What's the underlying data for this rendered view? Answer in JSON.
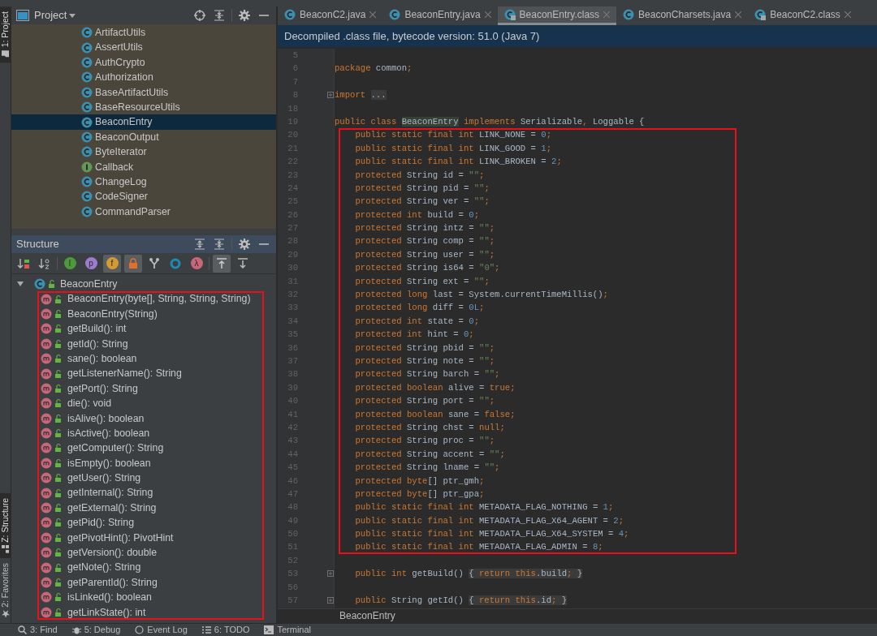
{
  "side_tabs_top": [
    {
      "label": "1: Project",
      "kind": "folder",
      "selected": true
    }
  ],
  "side_tabs_bottom": [
    {
      "label": "Z: Structure",
      "kind": "structure",
      "selected": true
    },
    {
      "label": "2: Favorites",
      "kind": "star",
      "selected": false
    }
  ],
  "project": {
    "title": "Project",
    "items": [
      {
        "label": "ArtifactUtils",
        "kind": "class",
        "selected": false
      },
      {
        "label": "AssertUtils",
        "kind": "class",
        "selected": false
      },
      {
        "label": "AuthCrypto",
        "kind": "class",
        "selected": false
      },
      {
        "label": "Authorization",
        "kind": "class",
        "selected": false
      },
      {
        "label": "BaseArtifactUtils",
        "kind": "class",
        "selected": false
      },
      {
        "label": "BaseResourceUtils",
        "kind": "class",
        "selected": false
      },
      {
        "label": "BeaconEntry",
        "kind": "class",
        "selected": true
      },
      {
        "label": "BeaconOutput",
        "kind": "class",
        "selected": false
      },
      {
        "label": "ByteIterator",
        "kind": "class",
        "selected": false
      },
      {
        "label": "Callback",
        "kind": "interface",
        "selected": false
      },
      {
        "label": "ChangeLog",
        "kind": "class",
        "selected": false
      },
      {
        "label": "CodeSigner",
        "kind": "class",
        "selected": false
      },
      {
        "label": "CommandParser",
        "kind": "class",
        "selected": false
      }
    ]
  },
  "structure": {
    "title": "Structure",
    "toolbar": [
      {
        "kind": "sort-visibility",
        "on": false
      },
      {
        "kind": "sort-alpha",
        "on": false
      },
      {
        "kind": "badge",
        "glyph": "I",
        "color": "#4c9a3c",
        "on": false
      },
      {
        "kind": "badge",
        "glyph": "p",
        "color": "#9b7cce",
        "on": false
      },
      {
        "kind": "badge",
        "glyph": "f",
        "color": "#d49a33",
        "on": true
      },
      {
        "kind": "lock",
        "on": true
      },
      {
        "kind": "fork",
        "on": false
      },
      {
        "kind": "ring",
        "on": false
      },
      {
        "kind": "badge",
        "glyph": "λ",
        "color": "#c8677a",
        "on": false
      },
      {
        "kind": "scroll-to-source",
        "on": true
      },
      {
        "kind": "scroll-from-source",
        "on": false
      }
    ],
    "root": {
      "label": "BeaconEntry",
      "expanded": true,
      "children": [
        {
          "label": "BeaconEntry(byte[], String, String, String)",
          "highlighted": true
        },
        {
          "label": "BeaconEntry(String)",
          "highlighted": true
        },
        {
          "label": "getBuild(): int",
          "highlighted": true
        },
        {
          "label": "getId(): String",
          "highlighted": true
        },
        {
          "label": "sane(): boolean",
          "highlighted": true
        },
        {
          "label": "getListenerName(): String",
          "highlighted": true
        },
        {
          "label": "getPort(): String",
          "highlighted": true
        },
        {
          "label": "die(): void",
          "highlighted": true
        },
        {
          "label": "isAlive(): boolean",
          "highlighted": true
        },
        {
          "label": "isActive(): boolean",
          "highlighted": true
        },
        {
          "label": "getComputer(): String",
          "highlighted": true
        },
        {
          "label": "isEmpty(): boolean",
          "highlighted": true
        },
        {
          "label": "getUser(): String",
          "highlighted": true
        },
        {
          "label": "getInternal(): String",
          "highlighted": true
        },
        {
          "label": "getExternal(): String",
          "highlighted": true
        },
        {
          "label": "getPid(): String",
          "highlighted": true
        },
        {
          "label": "getPivotHint(): PivotHint",
          "highlighted": true
        },
        {
          "label": "getVersion(): double",
          "highlighted": true
        },
        {
          "label": "getNote(): String",
          "highlighted": true
        },
        {
          "label": "getParentId(): String",
          "highlighted": true
        },
        {
          "label": "isLinked(): boolean",
          "highlighted": true
        },
        {
          "label": "getLinkState(): int",
          "highlighted": true
        }
      ]
    }
  },
  "editor": {
    "tabs": [
      {
        "label": "BeaconC2.java",
        "kind": "java",
        "selected": false
      },
      {
        "label": "BeaconEntry.java",
        "kind": "java",
        "selected": false
      },
      {
        "label": "BeaconEntry.class",
        "kind": "class",
        "selected": true
      },
      {
        "label": "BeaconCharsets.java",
        "kind": "java",
        "selected": false
      },
      {
        "label": "BeaconC2.class",
        "kind": "class",
        "selected": false
      }
    ],
    "banner": "Decompiled .class file, bytecode version: 51.0 (Java 7)",
    "lines": [
      {
        "n": "5",
        "fold_marker": false
      },
      {
        "n": "6",
        "highlighted": false,
        "fold_marker": false,
        "t": [
          {
            "kind": "keyword",
            "text": "package "
          },
          {
            "kind": "plain",
            "text": "common"
          },
          {
            "kind": "keyword",
            "text": ";"
          }
        ]
      },
      {
        "n": "7",
        "fold_marker": false
      },
      {
        "n": "8",
        "highlighted": false,
        "fold_marker": true,
        "t": [
          {
            "kind": "keyword",
            "text": "import "
          },
          {
            "kind": "folded",
            "text": "..."
          }
        ]
      },
      {
        "n": "18",
        "fold_marker": false
      },
      {
        "n": "19",
        "highlighted": false,
        "fold_marker": false,
        "t": [
          {
            "kind": "keyword",
            "text": "public class "
          },
          {
            "kind": "usage",
            "text": "BeaconEntry"
          },
          {
            "kind": "keyword",
            "text": " implements "
          },
          {
            "kind": "plain",
            "text": "Serializable"
          },
          {
            "kind": "keyword",
            "text": ", "
          },
          {
            "kind": "plain",
            "text": "Loggable {"
          }
        ]
      },
      {
        "n": "20",
        "highlighted": true,
        "fold_marker": false,
        "t": [
          {
            "kind": "keyword",
            "text": "    public static final int "
          },
          {
            "kind": "plain",
            "text": "LINK_NONE = "
          },
          {
            "kind": "number",
            "text": "0"
          },
          {
            "kind": "keyword",
            "text": ";"
          }
        ]
      },
      {
        "n": "21",
        "highlighted": true,
        "fold_marker": false,
        "t": [
          {
            "kind": "keyword",
            "text": "    public static final int "
          },
          {
            "kind": "plain",
            "text": "LINK_GOOD = "
          },
          {
            "kind": "number",
            "text": "1"
          },
          {
            "kind": "keyword",
            "text": ";"
          }
        ]
      },
      {
        "n": "22",
        "highlighted": true,
        "fold_marker": false,
        "t": [
          {
            "kind": "keyword",
            "text": "    public static final int "
          },
          {
            "kind": "plain",
            "text": "LINK_BROKEN = "
          },
          {
            "kind": "number",
            "text": "2"
          },
          {
            "kind": "keyword",
            "text": ";"
          }
        ]
      },
      {
        "n": "23",
        "highlighted": true,
        "fold_marker": false,
        "t": [
          {
            "kind": "keyword",
            "text": "    protected "
          },
          {
            "kind": "plain",
            "text": "String id = "
          },
          {
            "kind": "string",
            "text": "\"\""
          },
          {
            "kind": "keyword",
            "text": ";"
          }
        ]
      },
      {
        "n": "24",
        "highlighted": true,
        "fold_marker": false,
        "t": [
          {
            "kind": "keyword",
            "text": "    protected "
          },
          {
            "kind": "plain",
            "text": "String pid = "
          },
          {
            "kind": "string",
            "text": "\"\""
          },
          {
            "kind": "keyword",
            "text": ";"
          }
        ]
      },
      {
        "n": "25",
        "highlighted": true,
        "fold_marker": false,
        "t": [
          {
            "kind": "keyword",
            "text": "    protected "
          },
          {
            "kind": "plain",
            "text": "String ver = "
          },
          {
            "kind": "string",
            "text": "\"\""
          },
          {
            "kind": "keyword",
            "text": ";"
          }
        ]
      },
      {
        "n": "26",
        "highlighted": true,
        "fold_marker": false,
        "t": [
          {
            "kind": "keyword",
            "text": "    protected int "
          },
          {
            "kind": "plain",
            "text": "build = "
          },
          {
            "kind": "number",
            "text": "0"
          },
          {
            "kind": "keyword",
            "text": ";"
          }
        ]
      },
      {
        "n": "27",
        "highlighted": true,
        "fold_marker": false,
        "t": [
          {
            "kind": "keyword",
            "text": "    protected "
          },
          {
            "kind": "plain",
            "text": "String intz = "
          },
          {
            "kind": "string",
            "text": "\"\""
          },
          {
            "kind": "keyword",
            "text": ";"
          }
        ]
      },
      {
        "n": "28",
        "highlighted": true,
        "fold_marker": false,
        "t": [
          {
            "kind": "keyword",
            "text": "    protected "
          },
          {
            "kind": "plain",
            "text": "String comp = "
          },
          {
            "kind": "string",
            "text": "\"\""
          },
          {
            "kind": "keyword",
            "text": ";"
          }
        ]
      },
      {
        "n": "29",
        "highlighted": true,
        "fold_marker": false,
        "t": [
          {
            "kind": "keyword",
            "text": "    protected "
          },
          {
            "kind": "plain",
            "text": "String user = "
          },
          {
            "kind": "string",
            "text": "\"\""
          },
          {
            "kind": "keyword",
            "text": ";"
          }
        ]
      },
      {
        "n": "30",
        "highlighted": true,
        "fold_marker": false,
        "t": [
          {
            "kind": "keyword",
            "text": "    protected "
          },
          {
            "kind": "plain",
            "text": "String is64 = "
          },
          {
            "kind": "string",
            "text": "\"0\""
          },
          {
            "kind": "keyword",
            "text": ";"
          }
        ]
      },
      {
        "n": "31",
        "highlighted": true,
        "fold_marker": false,
        "t": [
          {
            "kind": "keyword",
            "text": "    protected "
          },
          {
            "kind": "plain",
            "text": "String ext = "
          },
          {
            "kind": "string",
            "text": "\"\""
          },
          {
            "kind": "keyword",
            "text": ";"
          }
        ]
      },
      {
        "n": "32",
        "highlighted": true,
        "fold_marker": false,
        "t": [
          {
            "kind": "keyword",
            "text": "    protected long "
          },
          {
            "kind": "plain",
            "text": "last = System.currentTimeMillis()"
          },
          {
            "kind": "keyword",
            "text": ";"
          }
        ]
      },
      {
        "n": "33",
        "highlighted": true,
        "fold_marker": false,
        "t": [
          {
            "kind": "keyword",
            "text": "    protected long "
          },
          {
            "kind": "plain",
            "text": "diff = "
          },
          {
            "kind": "number",
            "text": "0L"
          },
          {
            "kind": "keyword",
            "text": ";"
          }
        ]
      },
      {
        "n": "34",
        "highlighted": true,
        "fold_marker": false,
        "t": [
          {
            "kind": "keyword",
            "text": "    protected int "
          },
          {
            "kind": "plain",
            "text": "state = "
          },
          {
            "kind": "number",
            "text": "0"
          },
          {
            "kind": "keyword",
            "text": ";"
          }
        ]
      },
      {
        "n": "35",
        "highlighted": true,
        "fold_marker": false,
        "t": [
          {
            "kind": "keyword",
            "text": "    protected int "
          },
          {
            "kind": "plain",
            "text": "hint = "
          },
          {
            "kind": "number",
            "text": "0"
          },
          {
            "kind": "keyword",
            "text": ";"
          }
        ]
      },
      {
        "n": "36",
        "highlighted": true,
        "fold_marker": false,
        "t": [
          {
            "kind": "keyword",
            "text": "    protected "
          },
          {
            "kind": "plain",
            "text": "String pbid = "
          },
          {
            "kind": "string",
            "text": "\"\""
          },
          {
            "kind": "keyword",
            "text": ";"
          }
        ]
      },
      {
        "n": "37",
        "highlighted": true,
        "fold_marker": false,
        "t": [
          {
            "kind": "keyword",
            "text": "    protected "
          },
          {
            "kind": "plain",
            "text": "String note = "
          },
          {
            "kind": "string",
            "text": "\"\""
          },
          {
            "kind": "keyword",
            "text": ";"
          }
        ]
      },
      {
        "n": "38",
        "highlighted": true,
        "fold_marker": false,
        "t": [
          {
            "kind": "keyword",
            "text": "    protected "
          },
          {
            "kind": "plain",
            "text": "String barch = "
          },
          {
            "kind": "string",
            "text": "\"\""
          },
          {
            "kind": "keyword",
            "text": ";"
          }
        ]
      },
      {
        "n": "39",
        "highlighted": true,
        "fold_marker": false,
        "t": [
          {
            "kind": "keyword",
            "text": "    protected boolean "
          },
          {
            "kind": "plain",
            "text": "alive = "
          },
          {
            "kind": "keyword",
            "text": "true;"
          }
        ]
      },
      {
        "n": "40",
        "highlighted": true,
        "fold_marker": false,
        "t": [
          {
            "kind": "keyword",
            "text": "    protected "
          },
          {
            "kind": "plain",
            "text": "String port = "
          },
          {
            "kind": "string",
            "text": "\"\""
          },
          {
            "kind": "keyword",
            "text": ";"
          }
        ]
      },
      {
        "n": "41",
        "highlighted": true,
        "fold_marker": false,
        "t": [
          {
            "kind": "keyword",
            "text": "    protected boolean "
          },
          {
            "kind": "plain",
            "text": "sane = "
          },
          {
            "kind": "keyword",
            "text": "false;"
          }
        ]
      },
      {
        "n": "42",
        "highlighted": true,
        "fold_marker": false,
        "t": [
          {
            "kind": "keyword",
            "text": "    protected "
          },
          {
            "kind": "plain",
            "text": "String chst = "
          },
          {
            "kind": "keyword",
            "text": "null;"
          }
        ]
      },
      {
        "n": "43",
        "highlighted": true,
        "fold_marker": false,
        "t": [
          {
            "kind": "keyword",
            "text": "    protected "
          },
          {
            "kind": "plain",
            "text": "String proc = "
          },
          {
            "kind": "string",
            "text": "\"\""
          },
          {
            "kind": "keyword",
            "text": ";"
          }
        ]
      },
      {
        "n": "44",
        "highlighted": true,
        "fold_marker": false,
        "t": [
          {
            "kind": "keyword",
            "text": "    protected "
          },
          {
            "kind": "plain",
            "text": "String accent = "
          },
          {
            "kind": "string",
            "text": "\"\""
          },
          {
            "kind": "keyword",
            "text": ";"
          }
        ]
      },
      {
        "n": "45",
        "highlighted": true,
        "fold_marker": false,
        "t": [
          {
            "kind": "keyword",
            "text": "    protected "
          },
          {
            "kind": "plain",
            "text": "String lname = "
          },
          {
            "kind": "string",
            "text": "\"\""
          },
          {
            "kind": "keyword",
            "text": ";"
          }
        ]
      },
      {
        "n": "46",
        "highlighted": true,
        "fold_marker": false,
        "t": [
          {
            "kind": "keyword",
            "text": "    protected byte"
          },
          {
            "kind": "plain",
            "text": "[] ptr_gmh"
          },
          {
            "kind": "keyword",
            "text": ";"
          }
        ]
      },
      {
        "n": "47",
        "highlighted": true,
        "fold_marker": false,
        "t": [
          {
            "kind": "keyword",
            "text": "    protected byte"
          },
          {
            "kind": "plain",
            "text": "[] ptr_gpa"
          },
          {
            "kind": "keyword",
            "text": ";"
          }
        ]
      },
      {
        "n": "48",
        "highlighted": true,
        "fold_marker": false,
        "t": [
          {
            "kind": "keyword",
            "text": "    public static final int "
          },
          {
            "kind": "plain",
            "text": "METADATA_FLAG_NOTHING = "
          },
          {
            "kind": "number",
            "text": "1"
          },
          {
            "kind": "keyword",
            "text": ";"
          }
        ]
      },
      {
        "n": "49",
        "highlighted": true,
        "fold_marker": false,
        "t": [
          {
            "kind": "keyword",
            "text": "    public static final int "
          },
          {
            "kind": "plain",
            "text": "METADATA_FLAG_X64_AGENT = "
          },
          {
            "kind": "number",
            "text": "2"
          },
          {
            "kind": "keyword",
            "text": ";"
          }
        ]
      },
      {
        "n": "50",
        "highlighted": true,
        "fold_marker": false,
        "t": [
          {
            "kind": "keyword",
            "text": "    public static final int "
          },
          {
            "kind": "plain",
            "text": "METADATA_FLAG_X64_SYSTEM = "
          },
          {
            "kind": "number",
            "text": "4"
          },
          {
            "kind": "keyword",
            "text": ";"
          }
        ]
      },
      {
        "n": "51",
        "highlighted": true,
        "fold_marker": false,
        "t": [
          {
            "kind": "keyword",
            "text": "    public static final int "
          },
          {
            "kind": "plain",
            "text": "METADATA_FLAG_ADMIN = "
          },
          {
            "kind": "number",
            "text": "8"
          },
          {
            "kind": "keyword",
            "text": ";"
          }
        ]
      },
      {
        "n": "52",
        "fold_marker": false
      },
      {
        "n": "53",
        "highlighted": false,
        "fold_marker": true,
        "t": [
          {
            "kind": "keyword",
            "text": "    public int "
          },
          {
            "kind": "plain",
            "text": "getBuild() "
          },
          {
            "kind": "folded",
            "text": "{ "
          },
          {
            "kind": "folded-keyword",
            "text": "return this"
          },
          {
            "kind": "folded",
            "text": ".build"
          },
          {
            "kind": "folded-keyword",
            "text": ";"
          },
          {
            "kind": "folded",
            "text": " }"
          }
        ]
      },
      {
        "n": "56",
        "fold_marker": false
      },
      {
        "n": "57",
        "highlighted": false,
        "fold_marker": true,
        "t": [
          {
            "kind": "keyword",
            "text": "    public "
          },
          {
            "kind": "plain",
            "text": "String getId() "
          },
          {
            "kind": "folded",
            "text": "{ "
          },
          {
            "kind": "folded-keyword",
            "text": "return this"
          },
          {
            "kind": "folded",
            "text": ".id"
          },
          {
            "kind": "folded-keyword",
            "text": ";"
          },
          {
            "kind": "folded",
            "text": " }"
          }
        ]
      }
    ],
    "breadcrumb": "BeaconEntry"
  },
  "bottom_tools": [
    {
      "label": "3: Find",
      "kind": "search"
    },
    {
      "label": "5: Debug",
      "kind": "bug"
    },
    {
      "label": "Event Log",
      "kind": "log"
    },
    {
      "label": "6: TODO",
      "kind": "list"
    },
    {
      "label": "Terminal",
      "kind": "terminal"
    }
  ]
}
